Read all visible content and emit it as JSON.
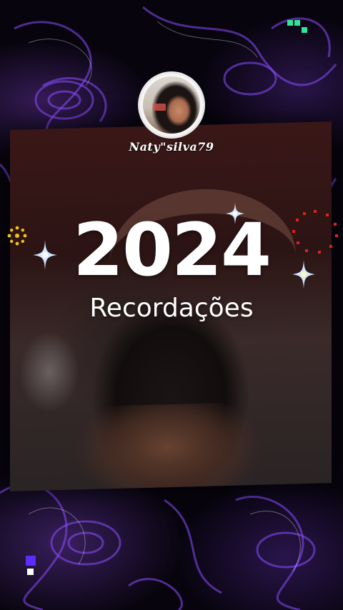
{
  "profile": {
    "username": "Naty\"silva79"
  },
  "title": {
    "year": "2024",
    "subtitle": "Recordações"
  },
  "colors": {
    "background": "#07040d",
    "swirl": "#8a4dff",
    "card": "#3a1717",
    "text": "#ffffff",
    "sparkle": "#cfe8ff",
    "gold_ring": "#f1c21b",
    "red_ring": "#e02020",
    "green_squares": "#2ee59d",
    "purple_squares": "#5b2bff"
  },
  "icons": [
    "sparkle-icon",
    "dotted-sun-icon",
    "dotted-circle-icon",
    "pixel-squares-icon"
  ]
}
